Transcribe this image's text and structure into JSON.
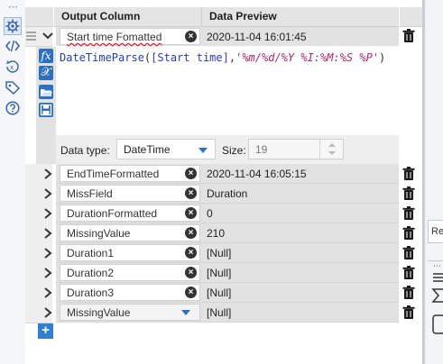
{
  "left_toolbar": {
    "icons": [
      "gear-icon",
      "code-icon",
      "fx-circle-icon",
      "tag-icon",
      "help-icon"
    ]
  },
  "grid": {
    "header_output": "Output Column",
    "header_preview": "Data Preview",
    "expanded_row": {
      "name": "Start time Fomatted",
      "preview": "2020-11-04 16:01:45",
      "formula_func": "DateTimeParse",
      "formula_arg": "[Start time]",
      "formula_format": "'%m/%d/%Y %I:%M:%S %P'",
      "data_type_label": "Data type:",
      "data_type_value": "DateTime",
      "size_label": "Size:",
      "size_value": "19"
    },
    "rows": [
      {
        "name": "EndTimeFormatted",
        "preview": "2020-11-04 16:05:15"
      },
      {
        "name": "MissField",
        "preview": "Duration"
      },
      {
        "name": "DurationFormatted",
        "preview": "0"
      },
      {
        "name": "MissingValue",
        "preview": "210"
      },
      {
        "name": "Duration1",
        "preview": "[Null]"
      },
      {
        "name": "Duration2",
        "preview": "[Null]"
      },
      {
        "name": "Duration3",
        "preview": "[Null]"
      },
      {
        "name": "MissingValue",
        "preview": "[Null]",
        "dropdown": true
      }
    ],
    "add_button": "+"
  },
  "right_panel": {
    "tab_text": "Re"
  }
}
